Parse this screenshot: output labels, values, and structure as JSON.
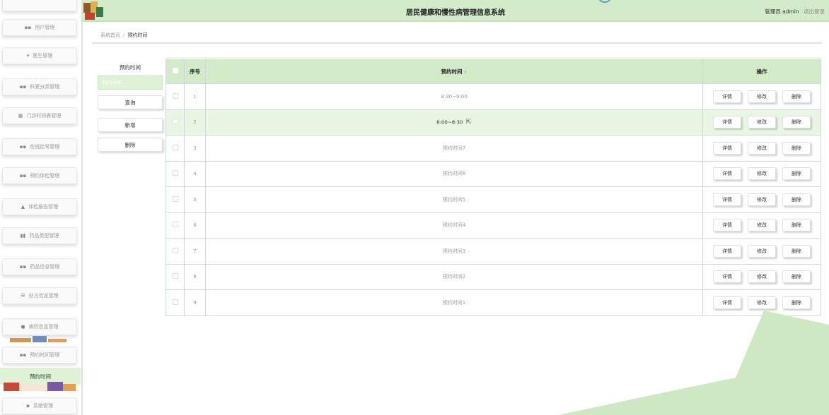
{
  "app": {
    "title": "居民健康和慢性病管理信息系统",
    "user": "管理员 admin",
    "logout": "退出登录"
  },
  "sidebar": {
    "items": [
      {
        "label": "用户管理",
        "icon": "grid-icon",
        "glyph": "▪▪"
      },
      {
        "label": "医生管理",
        "icon": "pin-icon",
        "glyph": "▾"
      },
      {
        "label": "科室分类管理",
        "icon": "grid-icon",
        "glyph": "▪▪"
      },
      {
        "label": "门诊时间表管理",
        "icon": "table-icon",
        "glyph": "▦"
      },
      {
        "label": "在线挂号管理",
        "icon": "grid-icon",
        "glyph": "▪▪"
      },
      {
        "label": "预约体检管理",
        "icon": "grid-icon",
        "glyph": "▪▪"
      },
      {
        "label": "体检报告管理",
        "icon": "person-icon",
        "glyph": "▲"
      },
      {
        "label": "药品类型管理",
        "icon": "chart-icon",
        "glyph": "▮▮"
      },
      {
        "label": "药品信息管理",
        "icon": "grid-icon",
        "glyph": "▪▪"
      },
      {
        "label": "处方信息管理",
        "icon": "sliders-icon",
        "glyph": "☰"
      },
      {
        "label": "病历信息管理",
        "icon": "location-icon",
        "glyph": "●"
      },
      {
        "label": "预约时间管理",
        "icon": "grid-icon",
        "glyph": "▪▪"
      }
    ],
    "active_sub": "预约时间",
    "last_item": {
      "label": "系统管理",
      "icon": "lock-icon",
      "glyph": "▪"
    }
  },
  "breadcrumb": {
    "home": "系统首页",
    "separator": "/",
    "current": "预约时间"
  },
  "panel": {
    "title": "预约时间",
    "input_placeholder": "预约时间",
    "search_label": "查询",
    "add_label": "新增",
    "delete_label": "删除"
  },
  "table": {
    "headers": {
      "index": "序号",
      "time": "预约时间",
      "sort": "⇕",
      "actions": "操作"
    },
    "action_labels": {
      "detail": "详情",
      "edit": "修改",
      "delete": "删除"
    },
    "rows": [
      {
        "index": "1",
        "time": "8:30~9:00"
      },
      {
        "index": "2",
        "time": "8:00~8:30"
      },
      {
        "index": "3",
        "time": "预约时间7"
      },
      {
        "index": "4",
        "time": "预约时间6"
      },
      {
        "index": "5",
        "time": "预约时间5"
      },
      {
        "index": "6",
        "time": "预约时间4"
      },
      {
        "index": "7",
        "time": "预约时间3"
      },
      {
        "index": "8",
        "time": "预约时间2"
      },
      {
        "index": "9",
        "time": "预约时间1"
      }
    ],
    "highlighted_row": 2
  },
  "colors": {
    "header_green": "#d4ebc9",
    "highlight_green": "#e9f6e3",
    "deco_green": "#cfe8c4"
  }
}
